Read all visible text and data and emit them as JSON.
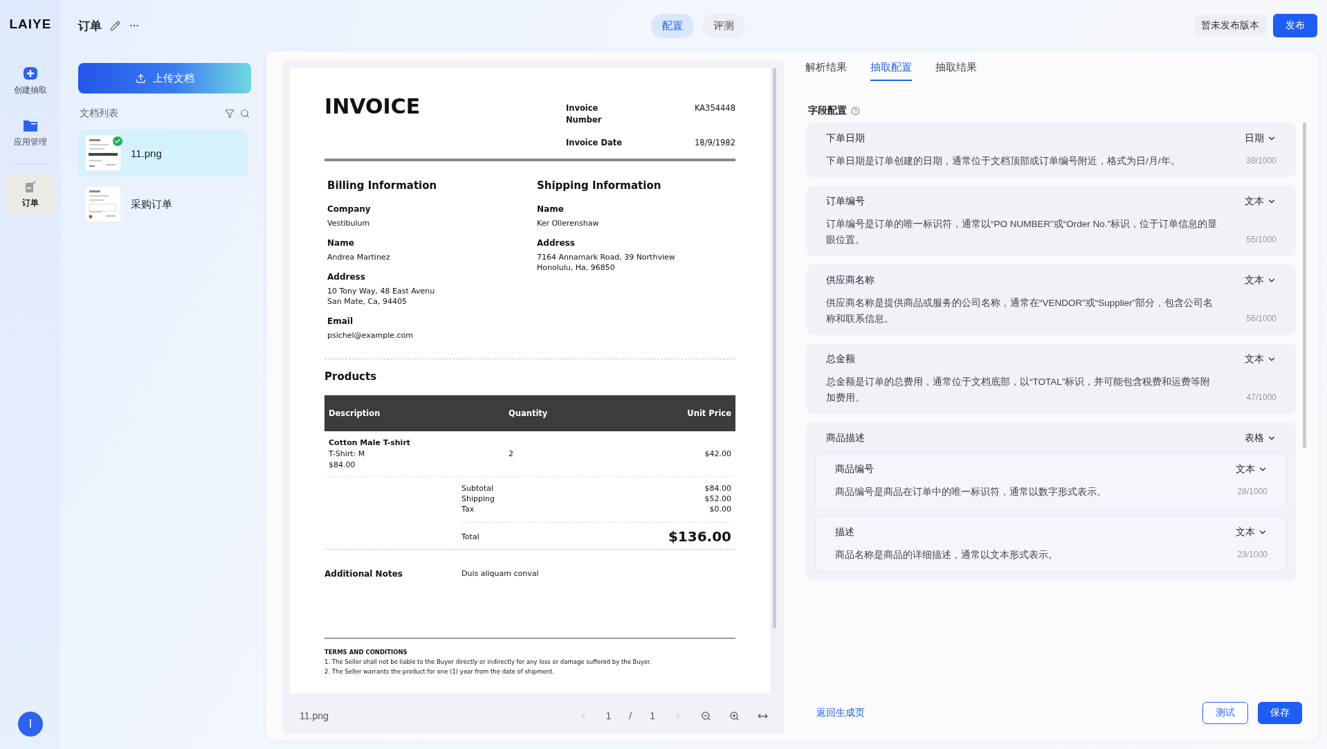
{
  "nav": {
    "logo": "LAIYE",
    "items": [
      {
        "kind": "create",
        "label": "创建抽取",
        "selected": false
      },
      {
        "kind": "apps",
        "label": "应用管理",
        "selected": false
      },
      {
        "kind": "order",
        "label": "订单",
        "selected": true
      }
    ],
    "avatar": "I"
  },
  "header": {
    "title": "订单",
    "mode_tabs": [
      {
        "label": "配置",
        "selected": true
      },
      {
        "label": "评测",
        "selected": false
      }
    ],
    "version_status": "暂未发布版本",
    "publish_button": "发布"
  },
  "documents": {
    "upload_button": "上传文档",
    "title": "文档列表",
    "items": [
      {
        "name": "11.png",
        "selected": true,
        "parsed": true
      },
      {
        "name": "采购订单",
        "selected": false,
        "parsed": false
      }
    ]
  },
  "viewer": {
    "invoice": {
      "title": "INVOICE",
      "meta": [
        {
          "label": "Invoice Number",
          "value": "KA354448"
        },
        {
          "label": "Invoice Date",
          "value": "18/9/1982"
        }
      ],
      "billing": {
        "heading": "Billing Information",
        "fields": [
          {
            "label": "Company",
            "lines": [
              "Vestibulum"
            ]
          },
          {
            "label": "Name",
            "lines": [
              "Andrea Martinez"
            ]
          },
          {
            "label": "Address",
            "lines": [
              "10 Tony Way, 48 East Avenu",
              "San Mate, Ca, 94405"
            ]
          },
          {
            "label": "Email",
            "lines": [
              "psichel@example.com"
            ]
          }
        ]
      },
      "shipping": {
        "heading": "Shipping Information",
        "fields": [
          {
            "label": "Name",
            "lines": [
              "Ker Ollerenshaw"
            ]
          },
          {
            "label": "Address",
            "lines": [
              "7164 Annamark Road, 39 Northview",
              "Honolulu, Ha, 96850"
            ]
          }
        ]
      },
      "products": {
        "heading": "Products",
        "columns": [
          "Description",
          "Quantity",
          "Unit Price"
        ],
        "rows": [
          {
            "name": "Cotton Male T-shirt",
            "variant": "T-Shirt: M",
            "amount": "$84.00",
            "quantity": "2",
            "unit_price": "$42.00"
          }
        ]
      },
      "summary": [
        {
          "label": "Subtotal",
          "value": "$84.00"
        },
        {
          "label": "Shipping",
          "value": "$52.00"
        },
        {
          "label": "Tax",
          "value": "$0.00"
        }
      ],
      "total": {
        "label": "Total",
        "value": "$136.00"
      },
      "notes": {
        "label": "Additional Notes",
        "value": "Duis aliquam conval"
      },
      "terms": {
        "heading": "TERMS AND CONDITIONS",
        "items": [
          "1. The Seller shall not be liable to the Buyer directly or indirectly for any loss or damage suffered by the Buyer.",
          "2. The Seller warrants the product for one (1) year from the date of shipment."
        ]
      }
    },
    "file_name": "11.png",
    "page": "1",
    "page_separator": "/",
    "page_total": "1"
  },
  "config": {
    "tabs": [
      {
        "label": "解析结果",
        "selected": false
      },
      {
        "label": "抽取配置",
        "selected": true
      },
      {
        "label": "抽取结果",
        "selected": false
      }
    ],
    "section_title": "字段配置",
    "fields": [
      {
        "name": "下单日期",
        "type": "日期",
        "description": "下单日期是订单创建的日期，通常位于文档顶部或订单编号附近，格式为日/月/年。",
        "count": "38/1000"
      },
      {
        "name": "订单编号",
        "type": "文本",
        "description": "订单编号是订单的唯一标识符，通常以“PO NUMBER”或“Order No.”标识，位于订单信息的显眼位置。",
        "count": "55/1000"
      },
      {
        "name": "供应商名称",
        "type": "文本",
        "description": "供应商名称是提供商品或服务的公司名称，通常在“VENDOR”或“Supplier”部分，包含公司名称和联系信息。",
        "count": "56/1000"
      },
      {
        "name": "总金额",
        "type": "文本",
        "description": "总金额是订单的总费用，通常位于文档底部，以“TOTAL”标识，并可能包含税费和运费等附加费用。",
        "count": "47/1000"
      },
      {
        "name": "商品描述",
        "type": "表格",
        "children": [
          {
            "name": "商品编号",
            "type": "文本",
            "description": "商品编号是商品在订单中的唯一标识符，通常以数字形式表示。",
            "count": "28/1000"
          },
          {
            "name": "描述",
            "type": "文本",
            "description": "商品名称是商品的详细描述，通常以文本形式表示。",
            "count": "23/1000"
          }
        ]
      }
    ],
    "back_link": "返回生成页",
    "test_button": "测试",
    "save_button": "保存"
  }
}
